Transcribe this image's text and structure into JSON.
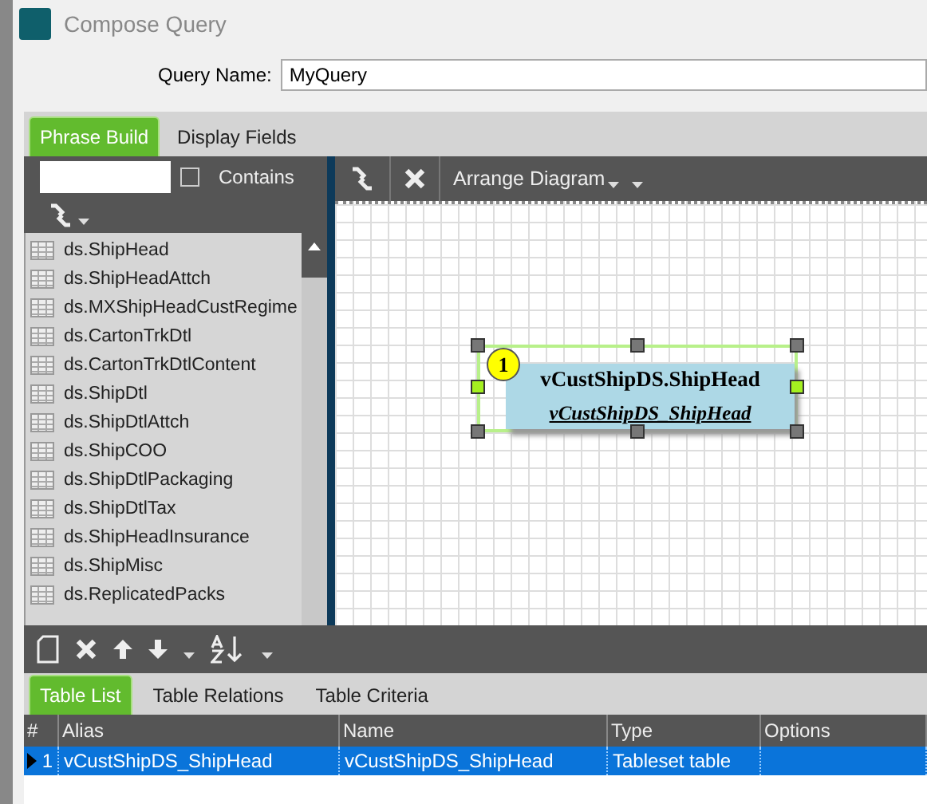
{
  "window": {
    "title": "Compose Query"
  },
  "query_name": {
    "label": "Query Name:",
    "value": "MyQuery"
  },
  "tabs": [
    {
      "label": "Phrase Build",
      "selected": true
    },
    {
      "label": "Display Fields",
      "selected": false
    }
  ],
  "table_search": {
    "contains_label": "Contains",
    "contains_checked": false
  },
  "tables": [
    "ds.ShipHead",
    "ds.ShipHeadAttch",
    "ds.MXShipHeadCustRegime",
    "ds.CartonTrkDtl",
    "ds.CartonTrkDtlContent",
    "ds.ShipDtl",
    "ds.ShipDtlAttch",
    "ds.ShipCOO",
    "ds.ShipDtlPackaging",
    "ds.ShipDtlTax",
    "ds.ShipHeadInsurance",
    "ds.ShipMisc",
    "ds.ReplicatedPacks"
  ],
  "diagram_toolbar": {
    "arrange_label": "Arrange Diagram"
  },
  "diagram_nodes": [
    {
      "number": "1",
      "title": "vCustShipDS.ShipHead",
      "alias": "vCustShipDS_ShipHead",
      "selected": true
    }
  ],
  "bottom_tabs": [
    {
      "label": "Table List",
      "selected": true
    },
    {
      "label": "Table Relations",
      "selected": false
    },
    {
      "label": "Table Criteria",
      "selected": false
    }
  ],
  "table": {
    "columns": [
      "#",
      "Alias",
      "Name",
      "Type",
      "Options"
    ],
    "rows": [
      {
        "cells": [
          "1",
          "vCustShipDS_ShipHead",
          "vCustShipDS_ShipHead",
          "Tableset table",
          ""
        ],
        "selected": true
      }
    ]
  }
}
